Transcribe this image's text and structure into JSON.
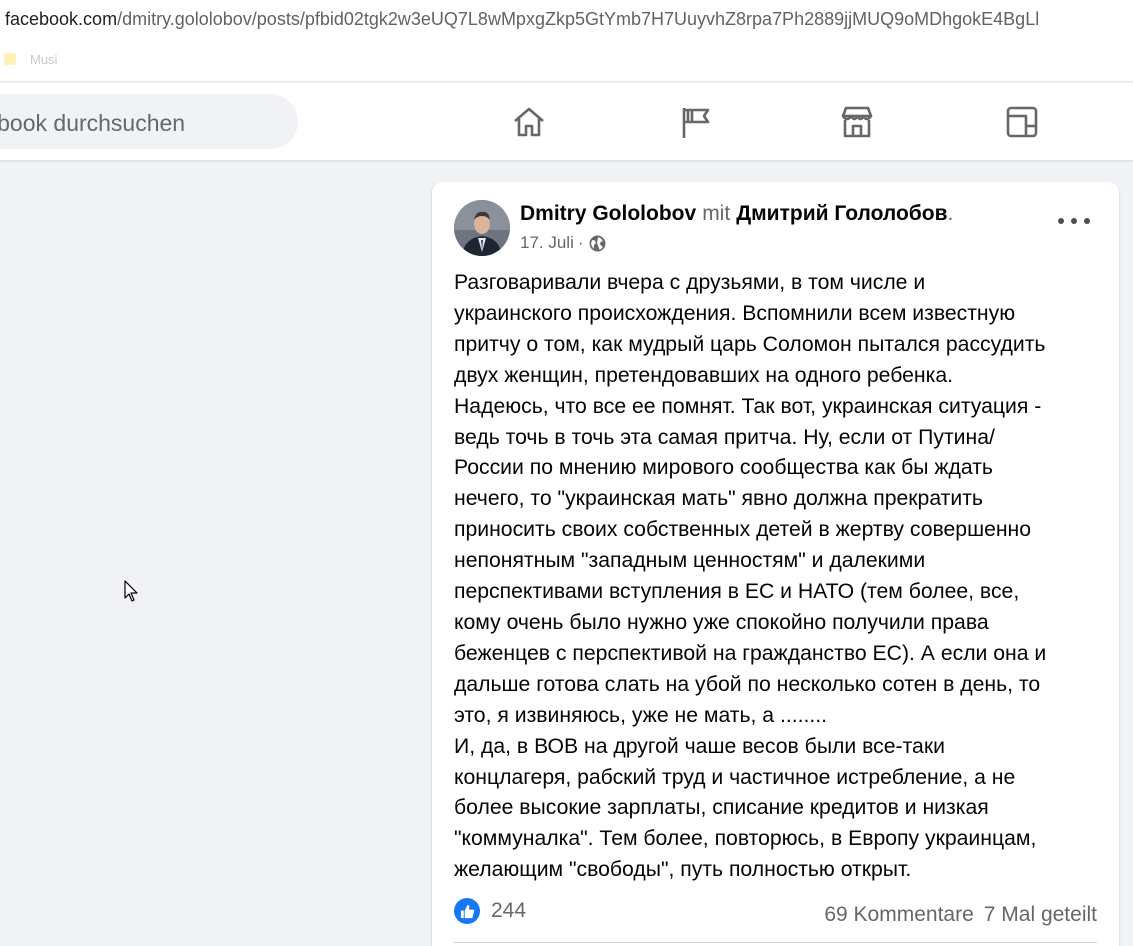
{
  "browser": {
    "url_host": "facebook.com",
    "url_path": "/dmitry.gololobov/posts/pfbid02tgk2w3eUQ7L8wMpxgZkp5GtYmb7H7UuyvhZ8rpa7Ph2889jjMUQ9oMDhgokE4BgLl",
    "bookmark_first": "Musi"
  },
  "header": {
    "search_placeholder": "Facebook durchsuchen",
    "nav_icons": [
      "home-icon",
      "flag-icon",
      "marketplace-icon",
      "groups-icon"
    ]
  },
  "post": {
    "author": "Dmitry Gololobov",
    "with_word": "mit",
    "tagged": "Дмитрий Гололобов",
    "tagged_suffix": ".",
    "date": "17. Juli",
    "date_separator": "·",
    "privacy_icon": "globe-icon",
    "text_lines": [
      "Разговаривали вчера с друзьями, в том числе и",
      "украинского происхождения. Вспомнили всем известную",
      "притчу о том, как мудрый царь Соломон пытался рассудить",
      "двух женщин, претендовавших на одного ребенка.",
      "Надеюсь, что все ее помнят. Так вот, украинская ситуация -",
      "ведь точь в точь эта самая притча. Ну, если от Путина/",
      "России по мнению мирового сообщества как бы ждать",
      "нечего, то \"украинская мать\" явно должна прекратить",
      "приносить своих собственных детей в жертву совершенно",
      "непонятным \"западным ценностям\" и далекими",
      "перспективами вступления в ЕС и НАТО (тем более, все,",
      "кому очень было нужно уже спокойно получили права",
      "беженцев с перспективой на гражданство ЕС). А если она и",
      "дальше готова слать на убой по несколько сотен в день, то",
      "это, я извиняюсь, уже не мать, а ........",
      "И, да, в ВОВ на другой чаше весов были все-таки",
      "концлагеря, рабский труд и частичное истребление, а не",
      "более высокие зарплаты, списание кредитов и низкая",
      "\"коммуналка\". Тем более, повторюсь, в Европу украинцам,",
      "желающим \"свободы\", путь полностью открыт."
    ],
    "reactions_count": "244",
    "comments": "69 Kommentare",
    "shares": "7 Mal geteilt"
  },
  "colors": {
    "accent": "#1877f2",
    "page_bg": "#f0f2f5",
    "secondary_text": "#65676b"
  }
}
